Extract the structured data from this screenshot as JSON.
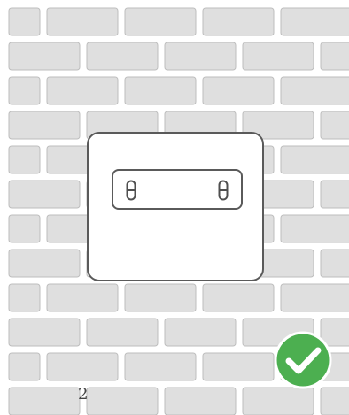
{
  "scene": {
    "wall_color": "#dfdfdf",
    "wall_border_color": "#bdbdbd",
    "sign_border_color": "#5a5a5a"
  },
  "footer": {
    "page_number": "2"
  },
  "status": {
    "icon": "checkmark-icon",
    "color": "#4caf50"
  }
}
